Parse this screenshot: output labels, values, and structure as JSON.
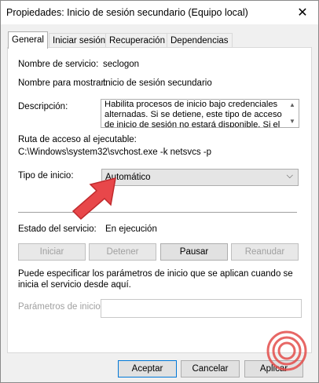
{
  "window": {
    "title": "Propiedades: Inicio de sesión secundario (Equipo local)"
  },
  "tabs": [
    {
      "label": "General",
      "active": true
    },
    {
      "label": "Iniciar sesión",
      "active": false
    },
    {
      "label": "Recuperación",
      "active": false
    },
    {
      "label": "Dependencias",
      "active": false
    }
  ],
  "general": {
    "service_name_label": "Nombre de servicio:",
    "service_name_value": "seclogon",
    "display_name_label": "Nombre para mostrar:",
    "display_name_value": "Inicio de sesión secundario",
    "description_label": "Descripción:",
    "description_value": "Habilita procesos de inicio bajo credenciales alternadas. Si se detiene, este tipo de acceso de inicio de sesión no estará disponible. Si el",
    "path_label": "Ruta de acceso al ejecutable:",
    "path_value": "C:\\Windows\\system32\\svchost.exe -k netsvcs -p",
    "startup_type_label": "Tipo de inicio:",
    "startup_type_value": "Automático",
    "status_label": "Estado del servicio:",
    "status_value": "En ejecución",
    "buttons": {
      "start": "Iniciar",
      "stop": "Detener",
      "pause": "Pausar",
      "resume": "Reanudar"
    },
    "hint": "Puede especificar los parámetros de inicio que se aplican cuando se inicia el servicio desde aquí.",
    "params_label": "Parámetros de inicio:",
    "params_value": ""
  },
  "footer": {
    "ok": "Aceptar",
    "cancel": "Cancelar",
    "apply": "Aplicar"
  },
  "colors": {
    "window_bg": "#f0f0f0",
    "panel_bg": "#ffffff",
    "combo_bg": "#e5e5e5",
    "focus_border": "#0078d7",
    "annotation_arrow": "#e8474a",
    "logo": "#e34c4a"
  }
}
